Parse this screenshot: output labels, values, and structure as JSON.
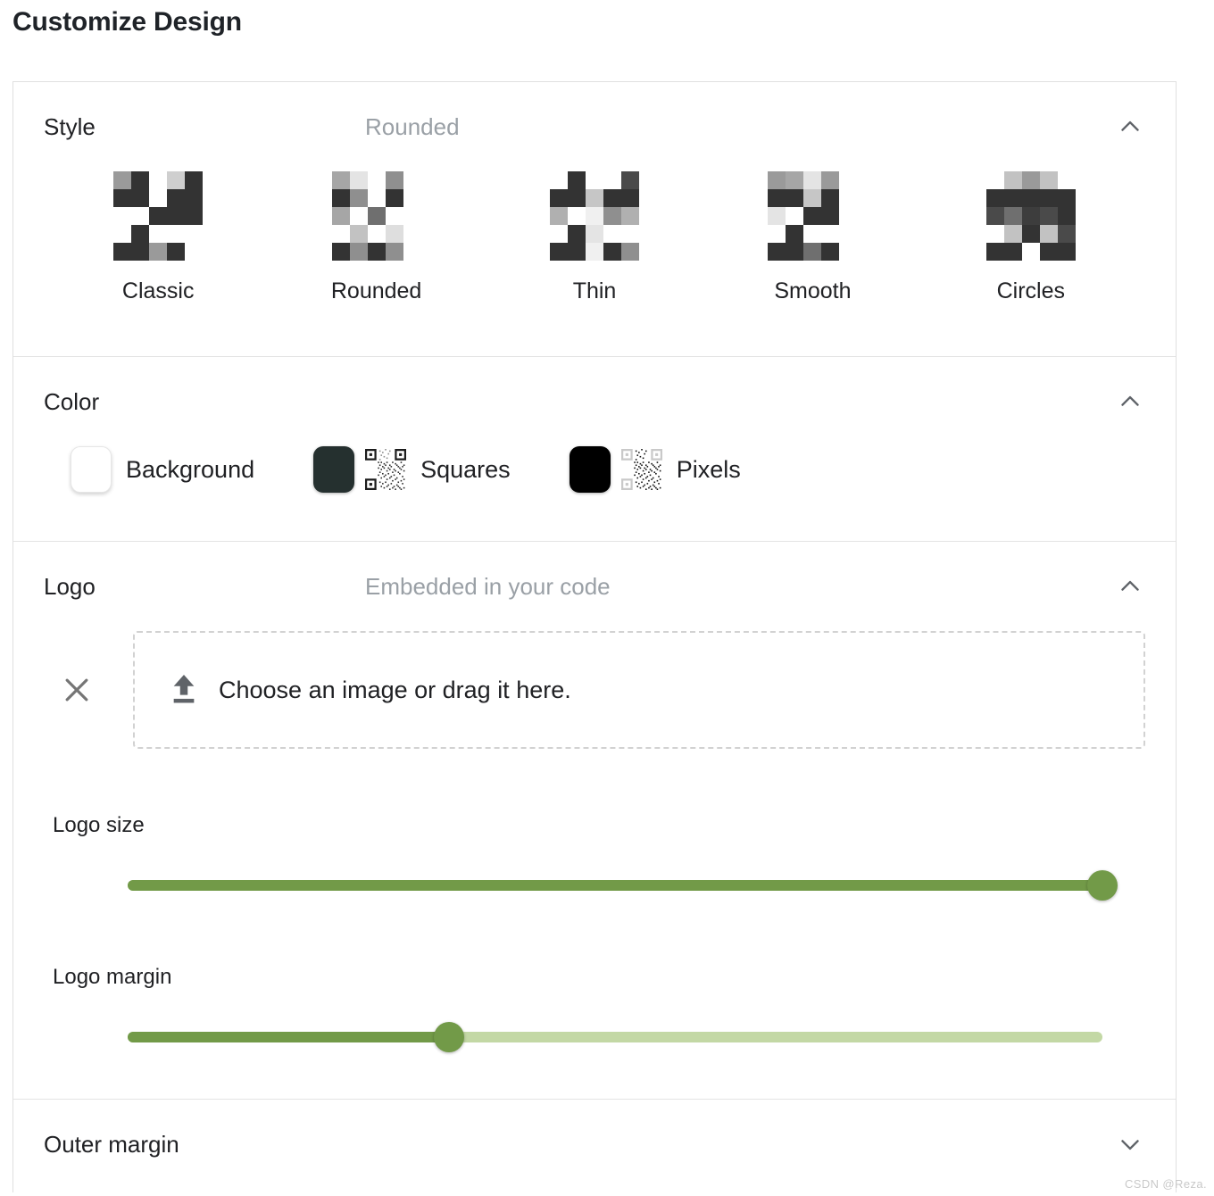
{
  "page": {
    "title": "Customize Design",
    "watermark": "CSDN @Reza."
  },
  "sections": {
    "style": {
      "title": "Style",
      "value": "Rounded",
      "expanded": true,
      "chevron": "chevron-up-icon",
      "options": [
        {
          "label": "Classic",
          "selected": false
        },
        {
          "label": "Rounded",
          "selected": true
        },
        {
          "label": "Thin",
          "selected": false
        },
        {
          "label": "Smooth",
          "selected": false
        },
        {
          "label": "Circles",
          "selected": false
        }
      ]
    },
    "color": {
      "title": "Color",
      "value": "",
      "expanded": true,
      "chevron": "chevron-up-icon",
      "swatches": [
        {
          "label": "Background",
          "color": "#ffffff",
          "has_preview": false
        },
        {
          "label": "Squares",
          "color": "#25302f",
          "has_preview": true
        },
        {
          "label": "Pixels",
          "color": "#000000",
          "has_preview": true
        }
      ]
    },
    "logo": {
      "title": "Logo",
      "value": "Embedded in your code",
      "expanded": true,
      "chevron": "chevron-up-icon",
      "remove_icon": "close-icon",
      "dropzone": {
        "icon": "upload-icon",
        "text": "Choose an image or drag it here."
      },
      "sliders": [
        {
          "label": "Logo size",
          "value": 100
        },
        {
          "label": "Logo margin",
          "value": 33
        }
      ]
    },
    "outer_margin": {
      "title": "Outer margin",
      "value": "",
      "expanded": false,
      "chevron": "chevron-down-icon"
    }
  },
  "colors": {
    "accent_green": "#729a48",
    "track_light": "#c3d8a5",
    "muted_text": "#9aa0a6",
    "border": "#e0e0e0"
  }
}
